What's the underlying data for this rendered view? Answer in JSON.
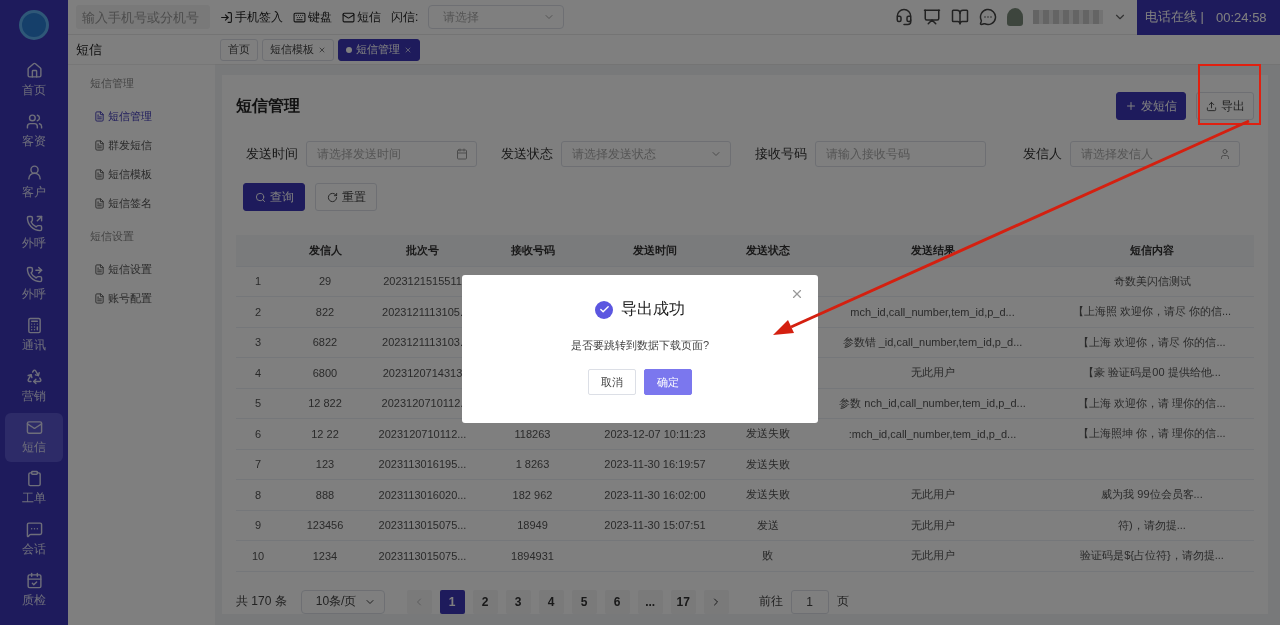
{
  "top_bar": {
    "search": {
      "placeholder": "输入手机号或分机号"
    },
    "actions": [
      "手机签入",
      "键盘",
      "短信"
    ],
    "flash_label": "闪信:",
    "flash_select": {
      "placeholder": "请选择"
    },
    "call_status": "电话在线 |",
    "call_timer": "00:24:58"
  },
  "nav": [
    {
      "label": "首页",
      "selected": false
    },
    {
      "label": "客资",
      "selected": false
    },
    {
      "label": "客户",
      "selected": false
    },
    {
      "label": "外呼",
      "selected": false
    },
    {
      "label": "外呼",
      "selected": false
    },
    {
      "label": "通讯",
      "selected": false
    },
    {
      "label": "营销",
      "selected": false
    },
    {
      "label": "短信",
      "selected": true
    },
    {
      "label": "工单",
      "selected": false
    },
    {
      "label": "会话",
      "selected": false
    },
    {
      "label": "质检",
      "selected": false
    }
  ],
  "submenu": {
    "title": "短信",
    "groups": [
      {
        "label": "短信管理",
        "items": [
          {
            "label": "短信管理",
            "selected": true
          },
          {
            "label": "群发短信",
            "selected": false
          },
          {
            "label": "短信模板",
            "selected": false
          },
          {
            "label": "短信签名",
            "selected": false
          }
        ]
      },
      {
        "label": "短信设置",
        "items": [
          {
            "label": "短信设置",
            "selected": false
          },
          {
            "label": "账号配置",
            "selected": false
          }
        ]
      }
    ]
  },
  "tabs": [
    {
      "label": "首页",
      "selected": false,
      "closable": false
    },
    {
      "label": "短信模板",
      "selected": false,
      "closable": true
    },
    {
      "label": "短信管理",
      "selected": true,
      "closable": true
    }
  ],
  "page": {
    "title": "短信管理",
    "buttons": {
      "create": "发短信",
      "export": "导出"
    }
  },
  "filters": [
    {
      "label": "发送时间",
      "placeholder": "请选择发送时间",
      "kind": "date"
    },
    {
      "label": "发送状态",
      "placeholder": "请选择发送状态",
      "kind": "select"
    },
    {
      "label": "接收号码",
      "placeholder": "请输入接收号码",
      "kind": "text"
    },
    {
      "label": "发信人",
      "placeholder": "请选择发信人",
      "kind": "user"
    }
  ],
  "filter_buttons": {
    "search": "查询",
    "reset": "重置"
  },
  "table": {
    "columns": [
      "",
      "发信人",
      "批次号",
      "接收号码",
      "发送时间",
      "发送状态",
      "发送结果",
      "短信内容"
    ],
    "rows": [
      [
        "1",
        "29",
        "2023121515511",
        null,
        null,
        null,
        null,
        "奇数美闪信测试"
      ],
      [
        "2",
        "822",
        "2023121113105.",
        null,
        null,
        null,
        "mch_id,call_number,tem_id,p_d...",
        "【上海照  欢迎你，请尽  你的信..."
      ],
      [
        "3",
        "6822",
        "2023121113103.",
        null,
        null,
        null,
        "参数错  _id,call_number,tem_id,p_d...",
        "【上海  欢迎你，请尽  你的信..."
      ],
      [
        "4",
        "6800",
        "2023120714313",
        null,
        null,
        null,
        "无此用户",
        "【豪  验证码是00  提供给他..."
      ],
      [
        "5",
        "12  822",
        "2023120710112.",
        null,
        null,
        null,
        "参数  nch_id,call_number,tem_id,p_d...",
        "【上海  欢迎你，请  理你的信..."
      ],
      [
        "6",
        "12  22",
        "2023120710112...",
        "118263",
        "2023-12-07 10:11:23",
        "发送失败",
        ":mch_id,call_number,tem_id,p_d...",
        "【上海照坤  你，请  理你的信..."
      ],
      [
        "7",
        "123",
        "2023113016195...",
        "1  8263",
        "2023-11-30 16:19:57",
        "发送失败",
        null,
        null
      ],
      [
        "8",
        "888",
        "2023113016020...",
        "182  962",
        "2023-11-30 16:02:00",
        "发送失败",
        "无此用户",
        "威为我  99位会员客..."
      ],
      [
        "9",
        "123456",
        "2023113015075...",
        "18949",
        "2023-11-30 15:07:51",
        "发送",
        "无此用户",
        "符)，请勿提..."
      ],
      [
        "10",
        "1234",
        "2023113015075...",
        "1894931",
        null,
        "败",
        "无此用户",
        "验证码是${占位符}，请勿提..."
      ]
    ]
  },
  "pagination": {
    "total": "共 170 条",
    "page_size": "10条/页",
    "pages": [
      {
        "label": "1",
        "selected": true
      },
      {
        "label": "2",
        "selected": false
      },
      {
        "label": "3",
        "selected": false
      },
      {
        "label": "4",
        "selected": false
      },
      {
        "label": "5",
        "selected": false
      },
      {
        "label": "6",
        "selected": false
      },
      {
        "label": "...",
        "selected": false
      },
      {
        "label": "17",
        "selected": false
      }
    ],
    "goto_label": "前往",
    "goto_value": "1",
    "page_suffix": "页"
  },
  "dialog": {
    "title": "导出成功",
    "message": "是否要跳转到数据下载页面?",
    "cancel": "取消",
    "confirm": "确定"
  }
}
